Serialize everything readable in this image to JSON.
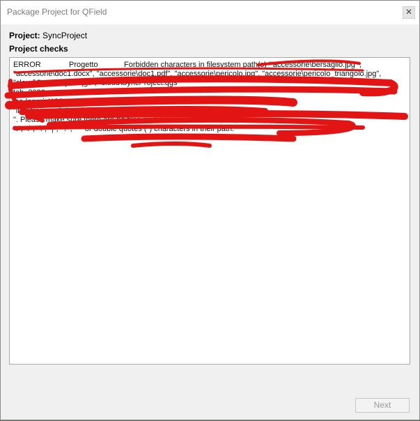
{
  "window": {
    "title": "Package Project for QField",
    "close_glyph": "✕"
  },
  "project": {
    "label": "Project:",
    "name": "SyncProject"
  },
  "checks": {
    "heading": "Project checks",
    "level": "ERROR",
    "source": "Progetto",
    "line1": "Forbidden characters in filesystem path(s) \"'accessorie\\bersaglio.jpg'\",",
    "line2": "\"accessorie\\doc1.docx\", \"accessorie\\doc1.pdf\", \"accessorie\\pericolo.jpg\", \"accessorie\\pericolo_triangolo.jpg\",",
    "line3": "\"cloud\\SyncProject.qgs\", \"cloud\\SyncProject.qgs\"",
    "line4": "tab_2022",
    "line5": "las-logo-inWhite.png\",",
    "line6": "\"img\\tree.png\", \"modelli\\...\"",
    "line7a": "\". Please make sure there are no files and directories with \"<\", \">\",",
    "line8": "\":\", \"/\", \"\\\", \"|\", \"?\", \"*\" or double quotes (\") characters in their path."
  },
  "buttons": {
    "next_label": "Next"
  },
  "colors": {
    "scribble": "#e31414",
    "window_bg": "#f0f0f0",
    "disabled_text": "#9a9a9a"
  }
}
